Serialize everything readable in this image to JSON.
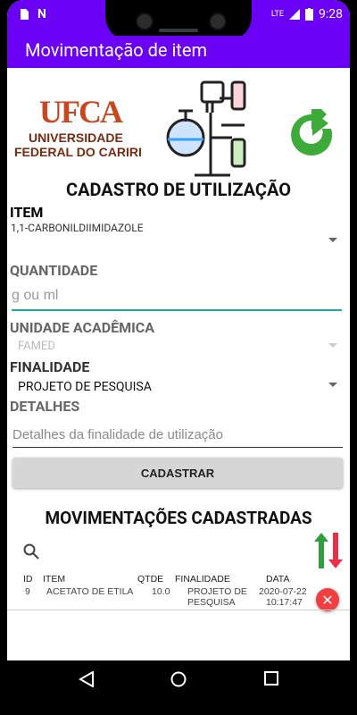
{
  "status_bar": {
    "time": "9:28",
    "network": "LTE",
    "left_icons": [
      "sim-card-icon",
      "n-icon"
    ]
  },
  "toolbar": {
    "title": "Movimentação de item"
  },
  "logos": {
    "ufca_word": "UFCA",
    "ufca_line1": "UNIVERSIDADE",
    "ufca_line2": "FEDERAL DO CARIRI"
  },
  "form": {
    "title": "CADASTRO DE UTILIZAÇÃO",
    "item_label": "ITEM",
    "item_value": "1,1-CARBONILDIIMIDAZOLE",
    "quantity_label": "QUANTIDADE",
    "quantity_placeholder": "g ou ml",
    "unit_label": "UNIDADE ACADÊMICA",
    "unit_value": "FAMED",
    "purpose_label": "FINALIDADE",
    "purpose_value": "PROJETO DE PESQUISA",
    "details_label": "DETALHES",
    "details_placeholder": "Detalhes da finalidade de utilização",
    "submit_label": "CADASTRAR"
  },
  "list": {
    "title": "MOVIMENTAÇÕES CADASTRADAS",
    "columns": [
      "ID",
      "ITEM",
      "QTDE",
      "FINALIDADE",
      "DATA"
    ],
    "rows": [
      {
        "id": "9",
        "item": "ACETATO DE ETILA",
        "qtde": "10.0",
        "finalidade_1": "PROJETO DE",
        "finalidade_2": "PESQUISA",
        "data_1": "2020-07-22",
        "data_2": "10:17:47"
      }
    ]
  },
  "colors": {
    "toolbar": "#6a00f4",
    "accent": "#1aa99f",
    "delete": "#f33f3f",
    "refresh": "#3cab3a"
  }
}
